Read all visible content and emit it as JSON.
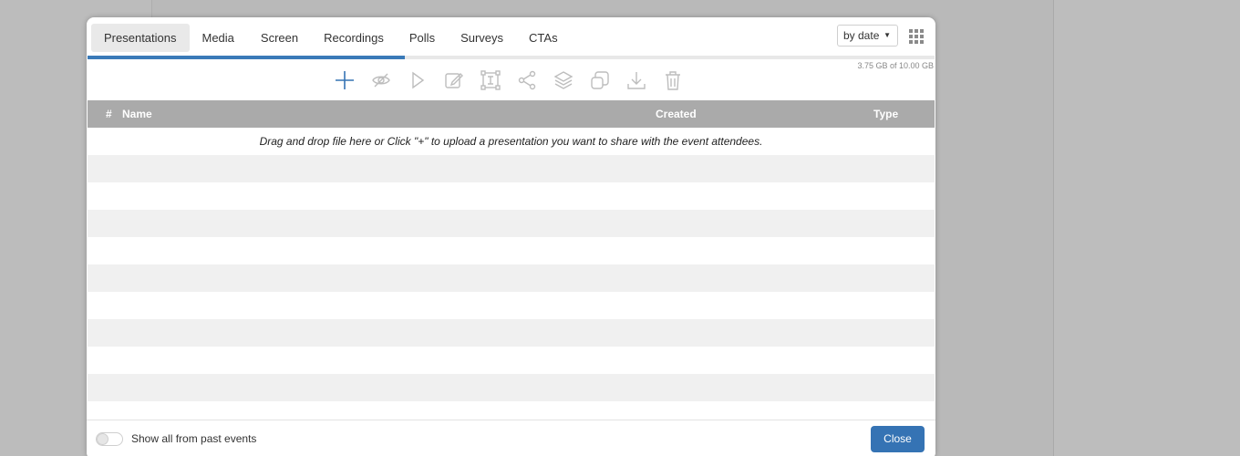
{
  "tabs": [
    {
      "label": "Presentations",
      "active": true
    },
    {
      "label": "Media"
    },
    {
      "label": "Screen"
    },
    {
      "label": "Recordings"
    },
    {
      "label": "Polls"
    },
    {
      "label": "Surveys"
    },
    {
      "label": "CTAs"
    }
  ],
  "sort": {
    "selected": "by date"
  },
  "storage": {
    "text": "3.75 GB of 10.00 GB",
    "used_fraction": 0.375
  },
  "toolbar": {
    "icons": [
      "plus-icon",
      "hide-icon",
      "play-icon",
      "edit-icon",
      "resize-icon",
      "share-icon",
      "layers-icon",
      "duplicate-icon",
      "download-icon",
      "trash-icon"
    ]
  },
  "table": {
    "columns": {
      "num": "#",
      "name": "Name",
      "created": "Created",
      "type": "Type"
    },
    "empty_message": "Drag and drop file here or Click \"+\" to upload a presentation you want to share with the event attendees."
  },
  "footer": {
    "toggle_label": "Show all from past events",
    "toggle_on": false,
    "close_label": "Close"
  },
  "colors": {
    "accent": "#3573b4",
    "header": "#aaaaaa"
  }
}
